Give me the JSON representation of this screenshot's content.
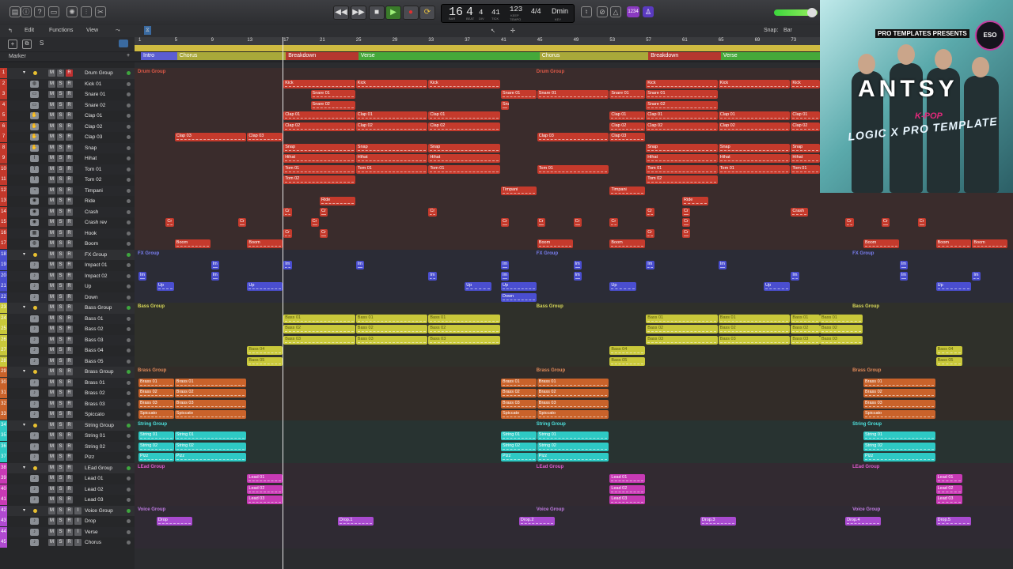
{
  "control_bar": {
    "position_bar": "16",
    "position_beat": "4",
    "position_div": "4",
    "position_tick": "41",
    "position_labels": [
      "BAR",
      "BEAT",
      "DIV",
      "TICK"
    ],
    "tempo": "123",
    "tempo_label_top": "KEEP",
    "tempo_label": "TEMPO",
    "time_signature": "4/4",
    "key": "Dmin",
    "key_label": "KEY",
    "badge": "1234"
  },
  "toolbar": {
    "edit_label": "Edit",
    "functions_label": "Functions",
    "view_label": "View",
    "snap_label": "Snap:",
    "snap_value": "Bar",
    "marker_label": "Marker",
    "s_button": "S"
  },
  "ruler": {
    "bars": [
      "1",
      "5",
      "9",
      "13",
      "17",
      "21",
      "25",
      "29",
      "33",
      "37",
      "41",
      "45",
      "49",
      "53",
      "57",
      "61",
      "65",
      "69",
      "73"
    ]
  },
  "markers": [
    {
      "label": "Intro",
      "color": "#5b5dd1"
    },
    {
      "label": "Chorus",
      "color": "#a9a83a"
    },
    {
      "label": "Breakdown",
      "color": "#b5372f"
    },
    {
      "label": "Verse",
      "color": "#45a83a"
    },
    {
      "label": "Chorus",
      "color": "#a9a83a"
    },
    {
      "label": "Breakdown",
      "color": "#b5372f"
    },
    {
      "label": "Verse",
      "color": "#45a83a"
    }
  ],
  "tracks": [
    {
      "num": "1",
      "name": "Drum Group",
      "folder": true,
      "color": "#c3382b"
    },
    {
      "num": "2",
      "name": "Kick 01",
      "color": "#c3382b"
    },
    {
      "num": "3",
      "name": "Snare 01",
      "color": "#c3382b"
    },
    {
      "num": "4",
      "name": "Snare 02",
      "color": "#c3382b"
    },
    {
      "num": "5",
      "name": "Clap 01",
      "color": "#c3382b"
    },
    {
      "num": "6",
      "name": "Clap 02",
      "color": "#c3382b"
    },
    {
      "num": "7",
      "name": "Clap 03",
      "color": "#c3382b"
    },
    {
      "num": "8",
      "name": "Snap",
      "color": "#c3382b"
    },
    {
      "num": "9",
      "name": "Hihat",
      "color": "#c3382b"
    },
    {
      "num": "10",
      "name": "Tom 01",
      "color": "#c3382b"
    },
    {
      "num": "11",
      "name": "Tom 02",
      "color": "#c3382b"
    },
    {
      "num": "12",
      "name": "Timpani",
      "color": "#c3382b"
    },
    {
      "num": "13",
      "name": "Ride",
      "color": "#c3382b"
    },
    {
      "num": "14",
      "name": "Crash",
      "color": "#c3382b"
    },
    {
      "num": "15",
      "name": "Crash rev",
      "color": "#c3382b"
    },
    {
      "num": "16",
      "name": "Hook",
      "color": "#c3382b"
    },
    {
      "num": "17",
      "name": "Boom",
      "color": "#c3382b"
    },
    {
      "num": "18",
      "name": "FX Group",
      "folder": true,
      "color": "#4a4ed0"
    },
    {
      "num": "19",
      "name": "Impact 01",
      "color": "#4a4ed0"
    },
    {
      "num": "20",
      "name": "Impact 02",
      "color": "#4a4ed0"
    },
    {
      "num": "21",
      "name": "Up",
      "color": "#4a4ed0"
    },
    {
      "num": "22",
      "name": "Down",
      "color": "#4a4ed0"
    },
    {
      "num": "23",
      "name": "Bass Group",
      "folder": true,
      "color": "#c9c83a"
    },
    {
      "num": "24",
      "name": "Bass 01",
      "color": "#c9c83a"
    },
    {
      "num": "25",
      "name": "Bass 02",
      "color": "#c9c83a"
    },
    {
      "num": "26",
      "name": "Bass 03",
      "color": "#c9c83a"
    },
    {
      "num": "27",
      "name": "Bass 04",
      "color": "#c9c83a"
    },
    {
      "num": "28",
      "name": "Bass 05",
      "color": "#c9c83a"
    },
    {
      "num": "29",
      "name": "Brass Group",
      "folder": true,
      "color": "#c9622a"
    },
    {
      "num": "30",
      "name": "Brass 01",
      "color": "#c9622a"
    },
    {
      "num": "31",
      "name": "Brass 02",
      "color": "#c9622a"
    },
    {
      "num": "32",
      "name": "Brass 03",
      "color": "#c9622a"
    },
    {
      "num": "33",
      "name": "Spiccato",
      "color": "#c9622a"
    },
    {
      "num": "34",
      "name": "String Group",
      "folder": true,
      "color": "#2ec9c4"
    },
    {
      "num": "35",
      "name": "String 01",
      "color": "#2ec9c4"
    },
    {
      "num": "36",
      "name": "String 02",
      "color": "#2ec9c4"
    },
    {
      "num": "37",
      "name": "Pizz",
      "color": "#2ec9c4"
    },
    {
      "num": "38",
      "name": "LEad Group",
      "folder": true,
      "color": "#c83ab5"
    },
    {
      "num": "39",
      "name": "Lead 01",
      "color": "#c83ab5"
    },
    {
      "num": "40",
      "name": "Lead 02",
      "color": "#c83ab5"
    },
    {
      "num": "41",
      "name": "Lead 03",
      "color": "#c83ab5"
    },
    {
      "num": "42",
      "name": "Voice Group",
      "folder": true,
      "color": "#b04ad0"
    },
    {
      "num": "43",
      "name": "Drop",
      "color": "#b04ad0"
    },
    {
      "num": "44",
      "name": "Verse",
      "color": "#b04ad0"
    },
    {
      "num": "45",
      "name": "Chorus",
      "color": "#b04ad0"
    }
  ],
  "group_labels": [
    "Drum Group",
    "FX Group",
    "Bass Group",
    "Brass Group",
    "String Group",
    "LEad Group",
    "Voice Group"
  ],
  "region_labels": {
    "kick": "Kick",
    "snare01": "Snare 01",
    "snare02": "Snare 02",
    "clap01": "Clap 01",
    "clap02": "Clap 02",
    "clap03": "Clap 03",
    "snap": "Snap",
    "hihat": "Hihat",
    "tom01": "Tom 01",
    "tom02": "Tom 02",
    "timpani": "Timpani",
    "ride": "Ride",
    "crash": "Crash",
    "cr": "Cr",
    "boom": "Boom",
    "im": "Im",
    "up": "Up",
    "down": "Down",
    "bass01": "Bass 01",
    "bass02": "Bass 02",
    "bass03": "Bass 03",
    "bass04": "Bass 04",
    "bass05": "Bass 05",
    "brass01": "Brass 01",
    "brass02": "Brass 02",
    "brass03": "Brass 03",
    "spiccato": "Spiccato",
    "string01": "String 01",
    "string02": "String 02",
    "pizz": "Pizz",
    "lead01": "Lead 01",
    "lead02": "Lead 02",
    "lead03": "Lead 03",
    "drop": "Drop",
    "drop1": "Drop.1",
    "drop2": "Drop.2",
    "drop3": "Drop.3",
    "drop4": "Drop.4",
    "drop5": "Drop.5"
  },
  "promo": {
    "presents": "PRO TEMPLATES PRESENTS",
    "title": "ANTSY",
    "subtitle": "K-POP",
    "line": "LOGIC X PRO TEMPLATE",
    "logo": "ESO"
  }
}
